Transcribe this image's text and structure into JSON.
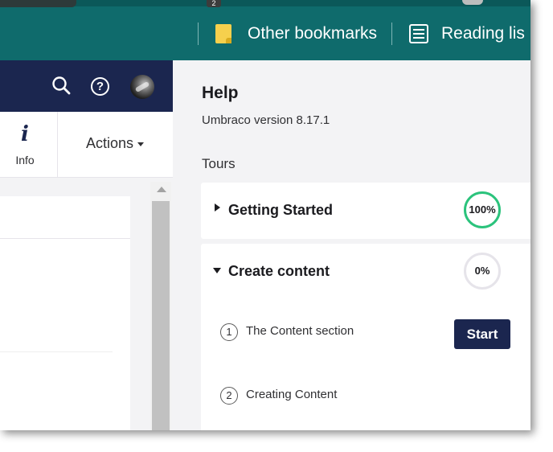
{
  "browser": {
    "tab_badge": "2",
    "bookmarks": [
      {
        "label": "Other bookmarks",
        "icon": "folder-icon"
      },
      {
        "label": "Reading lis",
        "icon": "reading-list-icon"
      }
    ],
    "bar_color": "#0f6b6c"
  },
  "header": {
    "icons": [
      "search-icon",
      "help-icon",
      "user-avatar"
    ],
    "help_glyph": "?",
    "color": "#1b264f"
  },
  "toolbar": {
    "info_label": "Info",
    "info_glyph": "i",
    "actions_label": "Actions"
  },
  "help": {
    "title": "Help",
    "version": "Umbraco version 8.17.1",
    "tours_heading": "Tours",
    "tours": [
      {
        "title": "Getting Started",
        "progress": "100%",
        "progress_value": 100,
        "expanded": false
      },
      {
        "title": "Create content",
        "progress": "0%",
        "progress_value": 0,
        "expanded": true,
        "steps": [
          {
            "number": "1",
            "label": "The Content section",
            "action": "Start"
          },
          {
            "number": "2",
            "label": "Creating Content"
          }
        ]
      }
    ],
    "complete_color": "#2bc37c",
    "incomplete_color": "#e6e4ea"
  }
}
